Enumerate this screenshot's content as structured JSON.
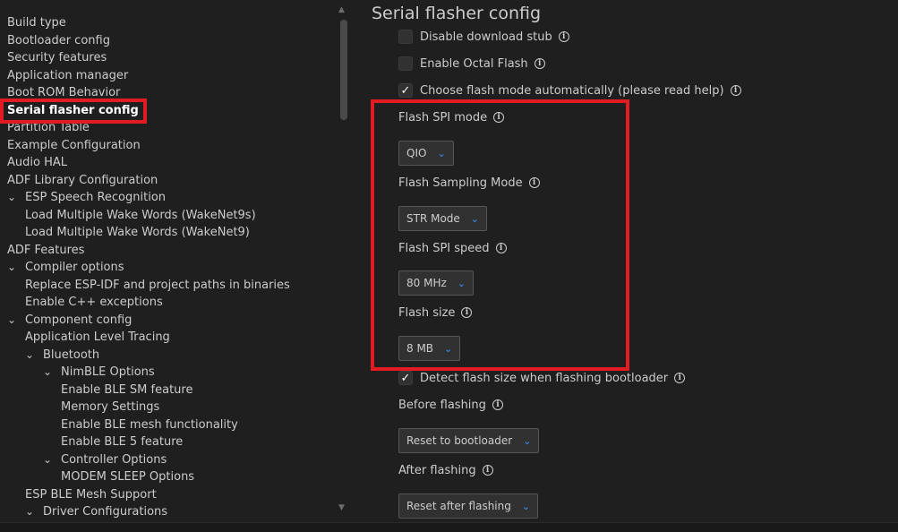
{
  "tree": {
    "items": [
      {
        "label": "Build type",
        "chevron": ""
      },
      {
        "label": "Bootloader config",
        "chevron": ""
      },
      {
        "label": "Security features",
        "chevron": ""
      },
      {
        "label": "Application manager",
        "chevron": ""
      },
      {
        "label": "Boot ROM Behavior",
        "chevron": ""
      },
      {
        "label": "Serial flasher config",
        "chevron": ""
      },
      {
        "label": "Partition Table",
        "chevron": ""
      },
      {
        "label": "Example Configuration",
        "chevron": ""
      },
      {
        "label": "Audio HAL",
        "chevron": ""
      },
      {
        "label": "ADF Library Configuration",
        "chevron": ""
      },
      {
        "label": "ESP Speech Recognition",
        "chevron": "⌄"
      },
      {
        "label": "Load Multiple Wake Words (WakeNet9s)",
        "chevron": ""
      },
      {
        "label": "Load Multiple Wake Words (WakeNet9)",
        "chevron": ""
      },
      {
        "label": "ADF Features",
        "chevron": ""
      },
      {
        "label": "Compiler options",
        "chevron": "⌄"
      },
      {
        "label": "Replace ESP-IDF and project paths in binaries",
        "chevron": ""
      },
      {
        "label": "Enable C++ exceptions",
        "chevron": ""
      },
      {
        "label": "Component config",
        "chevron": "⌄"
      },
      {
        "label": "Application Level Tracing",
        "chevron": ""
      },
      {
        "label": "Bluetooth",
        "chevron": "⌄"
      },
      {
        "label": "NimBLE Options",
        "chevron": "⌄"
      },
      {
        "label": "Enable BLE SM feature",
        "chevron": ""
      },
      {
        "label": "Memory Settings",
        "chevron": ""
      },
      {
        "label": "Enable BLE mesh functionality",
        "chevron": ""
      },
      {
        "label": "Enable BLE 5 feature",
        "chevron": ""
      },
      {
        "label": "Controller Options",
        "chevron": "⌄"
      },
      {
        "label": "MODEM SLEEP Options",
        "chevron": ""
      },
      {
        "label": "ESP BLE Mesh Support",
        "chevron": ""
      },
      {
        "label": "Driver Configurations",
        "chevron": "⌄"
      }
    ]
  },
  "main": {
    "title": "Serial flasher config",
    "checkboxes": [
      {
        "label": "Disable download stub",
        "checked": false,
        "mark": ""
      },
      {
        "label": "Enable Octal Flash",
        "checked": false,
        "mark": ""
      },
      {
        "label": "Choose flash mode automatically (please read help)",
        "checked": true,
        "mark": "✓"
      },
      {
        "label": "Detect flash size when flashing bootloader",
        "checked": true,
        "mark": "✓"
      }
    ],
    "fields": [
      {
        "label": "Flash SPI mode",
        "value": "QIO"
      },
      {
        "label": "Flash Sampling Mode",
        "value": "STR Mode"
      },
      {
        "label": "Flash SPI speed",
        "value": "80 MHz"
      },
      {
        "label": "Flash size",
        "value": "8 MB"
      },
      {
        "label": "Before flashing",
        "value": "Reset to bootloader"
      },
      {
        "label": "After flashing",
        "value": "Reset after flashing"
      }
    ],
    "info_glyph": "i",
    "chevron_glyph": "⌄"
  },
  "scrollbar": {
    "up": "▲",
    "down": "▼"
  },
  "colors": {
    "highlight": "#e31b23",
    "accent": "#3794ff",
    "background": "#1f1f1f"
  }
}
